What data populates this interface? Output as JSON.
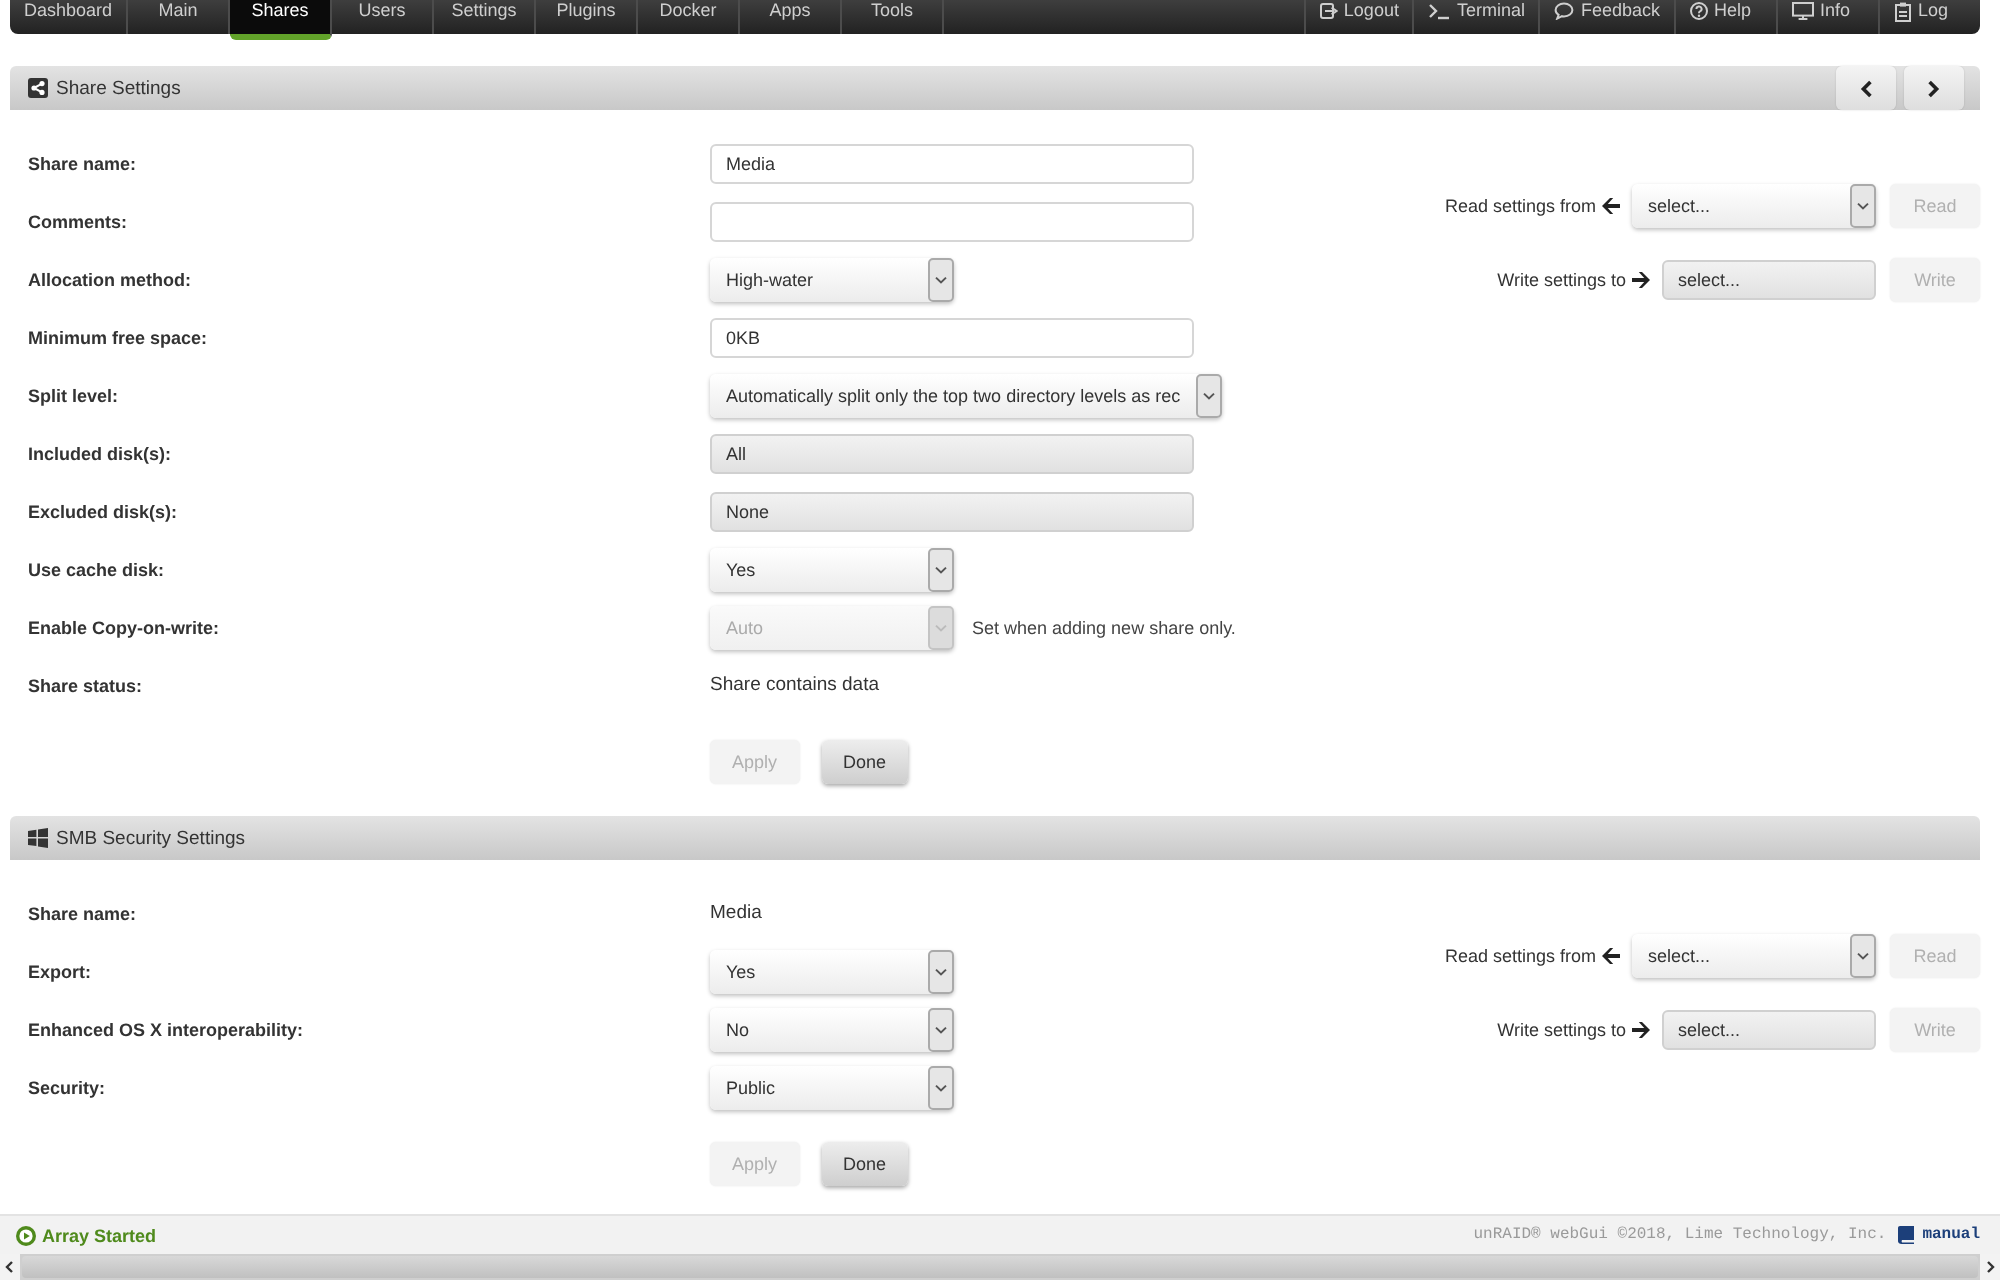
{
  "nav": {
    "tabs": [
      {
        "label": "Dashboard",
        "selected": false
      },
      {
        "label": "Main",
        "selected": false
      },
      {
        "label": "Shares",
        "selected": true
      },
      {
        "label": "Users",
        "selected": false
      },
      {
        "label": "Settings",
        "selected": false
      },
      {
        "label": "Plugins",
        "selected": false
      },
      {
        "label": "Docker",
        "selected": false
      },
      {
        "label": "Apps",
        "selected": false
      },
      {
        "label": "Tools",
        "selected": false
      }
    ],
    "actions": [
      {
        "label": "Logout"
      },
      {
        "label": "Terminal"
      },
      {
        "label": "Feedback"
      },
      {
        "label": "Help"
      },
      {
        "label": "Info"
      },
      {
        "label": "Log"
      }
    ]
  },
  "sections": [
    {
      "title": "Share Settings",
      "pager": true,
      "rows": [
        {
          "label": "Share name:",
          "kind": "input",
          "value": "Media"
        },
        {
          "label": "Comments:",
          "kind": "input"
        },
        {
          "label": "Allocation method:",
          "kind": "select",
          "value": "High-water",
          "disabled": false
        },
        {
          "label": "Minimum free space:",
          "kind": "input",
          "value": "0KB"
        },
        {
          "label": "Split level:",
          "kind": "select",
          "value": "Automatically split only the top two directory levels as rec",
          "disabled": false
        },
        {
          "label": "Included disk(s):",
          "kind": "picker",
          "value": "All"
        },
        {
          "label": "Excluded disk(s):",
          "kind": "picker",
          "value": "None"
        },
        {
          "label": "Use cache disk:",
          "kind": "select",
          "value": "Yes",
          "disabled": false
        },
        {
          "label": "Enable Copy-on-write:",
          "kind": "select",
          "value": "Auto",
          "disabled": true,
          "note": "Set when adding new share only."
        },
        {
          "label": "Share status:",
          "kind": "text",
          "value": "Share contains data"
        }
      ],
      "buttons": [
        {
          "label": "Apply",
          "disabled": true
        },
        {
          "label": "Done",
          "disabled": false
        }
      ],
      "transfer": [
        {
          "kind": "read",
          "label": "Read settings from",
          "value": "select...",
          "button": {
            "label": "Read",
            "disabled": true
          }
        },
        {
          "kind": "write",
          "label": "Write settings to",
          "value": "select...",
          "button": {
            "label": "Write",
            "disabled": true
          }
        }
      ]
    },
    {
      "title": "SMB Security Settings",
      "pager": false,
      "rows": [
        {
          "label": "Share name:",
          "kind": "text",
          "value": "Media"
        },
        {
          "label": "Export:",
          "kind": "select",
          "value": "Yes",
          "disabled": false
        },
        {
          "label": "Enhanced OS X interoperability:",
          "kind": "select",
          "value": "No",
          "disabled": false
        },
        {
          "label": "Security:",
          "kind": "select",
          "value": "Public",
          "disabled": false
        }
      ],
      "buttons": [
        {
          "label": "Apply",
          "disabled": true
        },
        {
          "label": "Done",
          "disabled": false
        }
      ],
      "transfer": [
        {
          "kind": "read",
          "label": "Read settings from",
          "value": "select...",
          "button": {
            "label": "Read",
            "disabled": true
          }
        },
        {
          "kind": "write",
          "label": "Write settings to",
          "value": "select...",
          "button": {
            "label": "Write",
            "disabled": true
          }
        }
      ]
    }
  ],
  "footer": {
    "status": "Array Started",
    "credit": "unRAID® webGui ©2018, Lime Technology, Inc.",
    "link": "manual"
  }
}
